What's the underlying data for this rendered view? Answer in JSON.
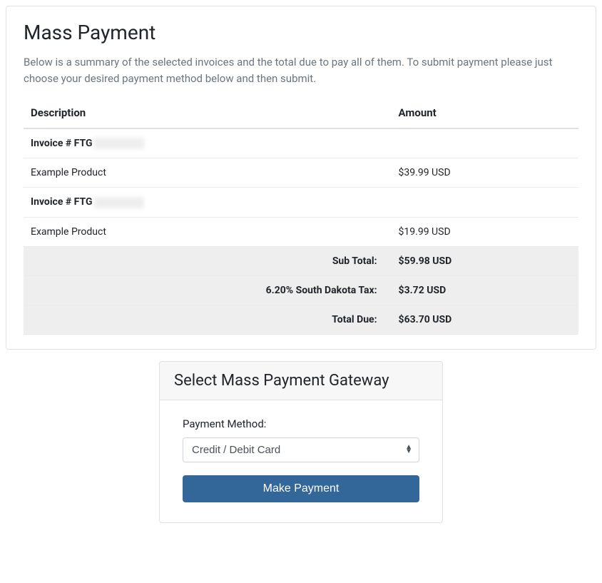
{
  "heading": "Mass Payment",
  "intro": "Below is a summary of the selected invoices and the total due to pay all of them. To submit payment please just choose your desired payment method below and then submit.",
  "table": {
    "col_description": "Description",
    "col_amount": "Amount"
  },
  "invoices": [
    {
      "label": "Invoice # FTG",
      "items": [
        {
          "name": "Example Product",
          "amount": "$39.99 USD"
        }
      ]
    },
    {
      "label": "Invoice # FTG",
      "items": [
        {
          "name": "Example Product",
          "amount": "$19.99 USD"
        }
      ]
    }
  ],
  "totals": {
    "subtotal_label": "Sub Total:",
    "subtotal_value": "$59.98 USD",
    "tax_label": "6.20% South Dakota Tax:",
    "tax_value": "$3.72 USD",
    "due_label": "Total Due:",
    "due_value": "$63.70 USD"
  },
  "gateway": {
    "title": "Select Mass Payment Gateway",
    "method_label": "Payment Method:",
    "selected_method": "Credit / Debit Card",
    "submit_label": "Make Payment"
  }
}
